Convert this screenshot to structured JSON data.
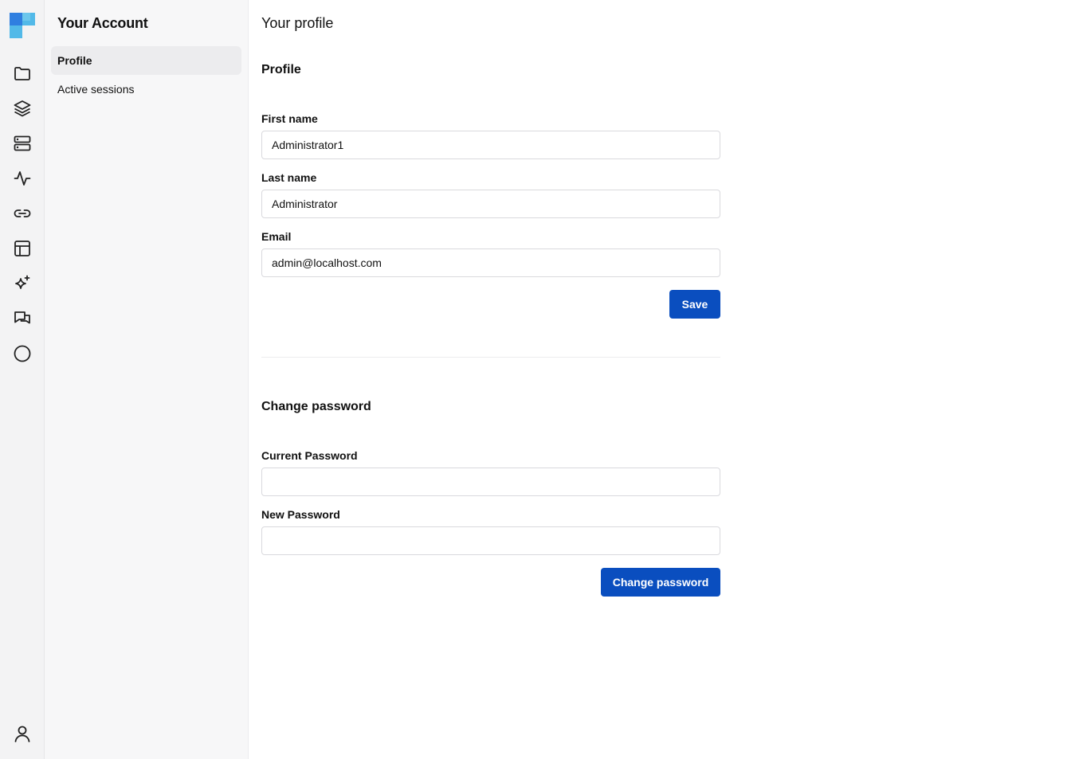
{
  "rail": {
    "icons": [
      "folder-icon",
      "layers-icon",
      "server-icon",
      "activity-icon",
      "link-icon",
      "table-icon",
      "sparkles-icon",
      "messages-icon",
      "circle-icon"
    ],
    "user_icon": "user-icon"
  },
  "sidebar": {
    "title": "Your Account",
    "items": [
      {
        "label": "Profile",
        "active": true
      },
      {
        "label": "Active sessions",
        "active": false
      }
    ]
  },
  "main": {
    "page_title": "Your profile",
    "profile": {
      "heading": "Profile",
      "first_name_label": "First name",
      "first_name_value": "Administrator1",
      "last_name_label": "Last name",
      "last_name_value": "Administrator",
      "email_label": "Email",
      "email_value": "admin@localhost.com",
      "save_label": "Save"
    },
    "password": {
      "heading": "Change password",
      "current_label": "Current Password",
      "current_value": "",
      "new_label": "New Password",
      "new_value": "",
      "submit_label": "Change password"
    }
  },
  "colors": {
    "accent": "#0a4ebf",
    "rail_bg": "#f3f3f4",
    "sidebar_bg": "#f7f7f8"
  }
}
